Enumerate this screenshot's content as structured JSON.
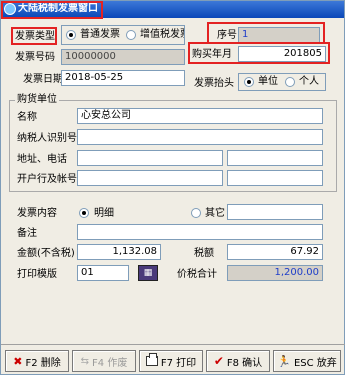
{
  "window": {
    "title": "大陆税制发票窗口"
  },
  "invoice_type": {
    "label": "发票类型",
    "options": [
      "普通发票",
      "增值税发票"
    ],
    "selected": "普通发票"
  },
  "seq": {
    "label": "序号",
    "value": "1"
  },
  "invoice_no": {
    "label": "发票号码",
    "value": "10000000"
  },
  "purchase_month": {
    "label": "购买年月",
    "value": "201805"
  },
  "invoice_date": {
    "label": "发票日期",
    "value": "2018-05-25"
  },
  "invoice_header": {
    "label": "发票抬头",
    "options": [
      "单位",
      "个人"
    ],
    "selected": "单位"
  },
  "buyer": {
    "group_title": "购货单位",
    "name_label": "名称",
    "name_value": "心安总公司",
    "taxid_label": "纳税人识别号",
    "taxid_value": "",
    "address_label": "地址、电话",
    "address_value": "",
    "phone_value": "",
    "bank_label": "开户行及帐号",
    "bank_value": "",
    "account_value": ""
  },
  "content": {
    "label": "发票内容",
    "options": [
      "明细",
      "其它"
    ],
    "selected": "明细",
    "other_value": ""
  },
  "remark": {
    "label": "备注",
    "value": ""
  },
  "amount": {
    "label": "金额(不含税)",
    "value": "1,132.08"
  },
  "tax": {
    "label": "税额",
    "value": "67.92"
  },
  "print_template": {
    "label": "打印模版",
    "value": "01"
  },
  "total": {
    "label": "价税合计",
    "value": "1,200.00"
  },
  "buttons": {
    "delete": "F2 删除",
    "void": "F4 作废",
    "print": "F7 打印",
    "confirm": "F8 确认",
    "cancel": "ESC 放弃"
  },
  "colors": {
    "highlight": "#e32222",
    "title_bar": "#0a47b8",
    "total_text": "#1f3ec9"
  }
}
